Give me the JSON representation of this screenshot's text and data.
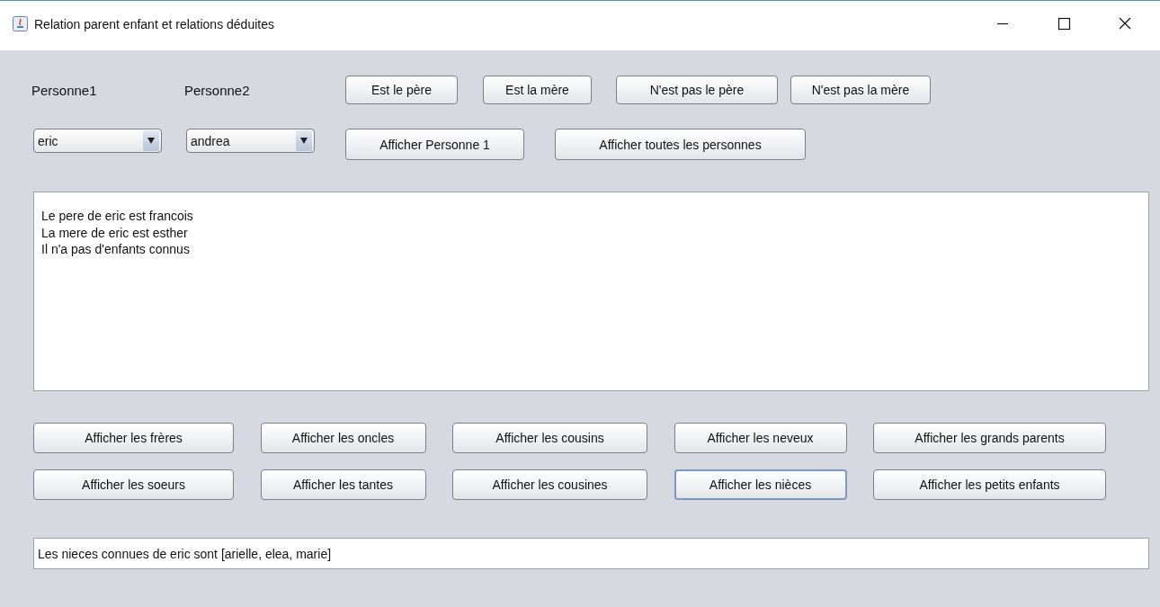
{
  "window": {
    "title": "Relation parent enfant et relations déduites"
  },
  "persons": [
    {
      "label": "Personne1",
      "value": "eric"
    },
    {
      "label": "Personne2",
      "value": "andrea"
    }
  ],
  "action_rows": [
    [
      "Est le père",
      "Est la mère",
      "N'est pas le père",
      "N'est pas la mère"
    ],
    [
      "Afficher Personne 1",
      "Afficher toutes les personnes"
    ]
  ],
  "output_lines": [
    "Le pere de eric est francois",
    "La mere de eric est esther",
    "Il n'a pas d'enfants connus"
  ],
  "relation_rows": [
    [
      {
        "label": "Afficher les frères",
        "focused": false
      },
      {
        "label": "Afficher les oncles",
        "focused": false
      },
      {
        "label": "Afficher les cousins",
        "focused": false
      },
      {
        "label": "Afficher les neveux",
        "focused": false
      },
      {
        "label": "Afficher les grands parents",
        "focused": false
      }
    ],
    [
      {
        "label": "Afficher les soeurs",
        "focused": false
      },
      {
        "label": "Afficher les tantes",
        "focused": false
      },
      {
        "label": "Afficher les cousines",
        "focused": false
      },
      {
        "label": "Afficher les nièces",
        "focused": true
      },
      {
        "label": "Afficher les petits enfants",
        "focused": false
      }
    ]
  ],
  "result": {
    "value": "Les nieces connues de eric sont [arielle, elea, marie]"
  }
}
